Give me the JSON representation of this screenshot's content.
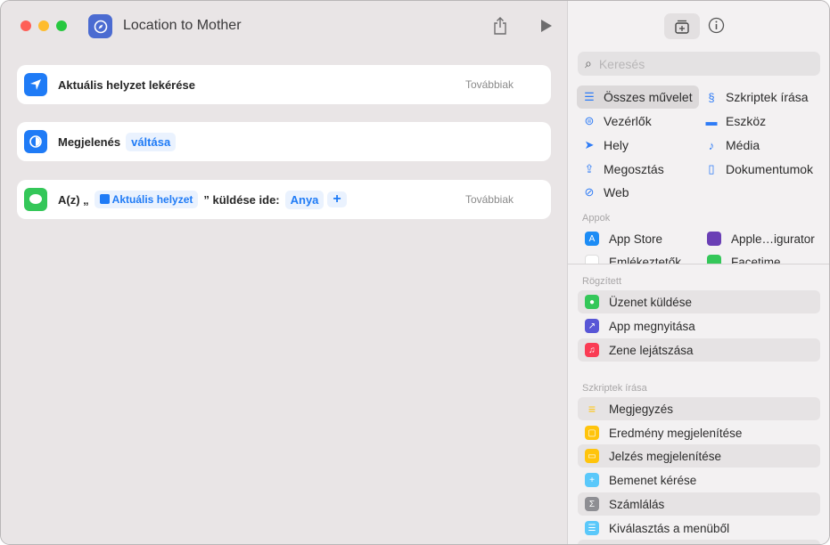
{
  "window": {
    "title": "Location to Mother"
  },
  "actions": [
    {
      "label": "Aktuális helyzet lekérése",
      "more": "Továbbiak"
    },
    {
      "label": "Megjelenés",
      "token": "váltása"
    },
    {
      "prefix": "A(z) „",
      "token": "Aktuális helyzet",
      "middle": "” küldése ide:",
      "recipient": "Anya",
      "add": "+",
      "more": "Továbbiak"
    }
  ],
  "sidebar": {
    "search_placeholder": "Keresés",
    "categories": [
      {
        "label": "Összes művelet",
        "icon": "list-icon",
        "selected": true
      },
      {
        "label": "Szkriptek írása",
        "icon": "script-icon"
      },
      {
        "label": "Vezérlők",
        "icon": "toggle-icon"
      },
      {
        "label": "Eszköz",
        "icon": "display-icon"
      },
      {
        "label": "Hely",
        "icon": "location-icon"
      },
      {
        "label": "Média",
        "icon": "music-note-icon"
      },
      {
        "label": "Megosztás",
        "icon": "share-icon"
      },
      {
        "label": "Dokumentumok",
        "icon": "document-icon"
      },
      {
        "label": "Web",
        "icon": "compass-icon"
      }
    ],
    "apps_header": "Appok",
    "apps": [
      "App Store",
      "Apple…igurator",
      "Emlékeztetők",
      "Facetime"
    ],
    "pinned_header": "Rögzített",
    "pinned": [
      "Üzenet küldése",
      "App megnyitása",
      "Zene lejátszása"
    ],
    "scripting_header": "Szkriptek írása",
    "scripting": [
      "Megjegyzés",
      "Eredmény megjelenítése",
      "Jelzés megjelenítése",
      "Bemenet kérése",
      "Számlálás",
      "Kiválasztás a menüből"
    ]
  },
  "colors": {
    "accent": "#1f7bf6",
    "messages": "#34c759",
    "music": "#fa3c54",
    "open_app": "#5856d6",
    "yellow": "#ffc40c",
    "gray": "#8e8e93",
    "cyan": "#5ac8fa"
  }
}
